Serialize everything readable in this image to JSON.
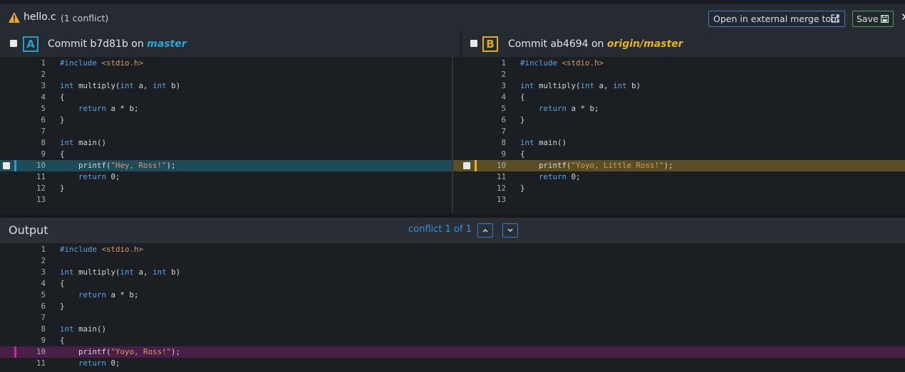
{
  "header": {
    "file_name": "hello.c",
    "conflict_count": "(1 conflict)",
    "external_tool_label": "Open in external merge tool",
    "save_label": "Save",
    "close_glyph": "✕"
  },
  "panel_a": {
    "badge": "A",
    "commit_label": "Commit b7d81b on ",
    "branch": "master",
    "accent": "#27a0c8"
  },
  "panel_b": {
    "badge": "B",
    "commit_label": "Commit ab4694 on ",
    "branch": "origin/master",
    "accent": "#e1ab20"
  },
  "output": {
    "title": "Output",
    "conflict_nav": "conflict 1 of 1",
    "accent": "#c0289e"
  },
  "code_a": [
    "1",
    "2",
    "3",
    "4",
    "5",
    "6",
    "7",
    "8",
    "9",
    "10",
    "11",
    "12",
    "13"
  ],
  "code_b": [
    "1",
    "2",
    "3",
    "4",
    "5",
    "6",
    "7",
    "8",
    "9",
    "10",
    "11",
    "12",
    "13"
  ],
  "code_out": [
    "1",
    "2",
    "3",
    "4",
    "5",
    "6",
    "7",
    "8",
    "9",
    "10",
    "11"
  ],
  "line_text": {
    "l1_pp": "#include",
    "l1_inc": " <stdio.h>",
    "l3_kw": "int",
    "l3_rest1": " multiply(",
    "l3_kw2": "int",
    "l3_rest2": " a, ",
    "l3_kw3": "int",
    "l3_rest3": " b)",
    "brace_open": "{",
    "l5_kw": "return",
    "l5_rest": " a * b;",
    "brace_close": "}",
    "l8_kw": "int",
    "l8_rest": " main()",
    "printf": "printf(",
    "str_a": "\"Hey, Ross!\"",
    "str_b": "\"Yoyo, Little Ross!\"",
    "str_out": "\"Yoyo, Ross!\"",
    "printf_end": ");",
    "l11_kw": "return",
    "l11_rest": " 0;"
  },
  "icons": {
    "warning": "warning-icon",
    "external": "external-link-icon",
    "save": "floppy-disk-icon",
    "up": "chevron-up-icon",
    "down": "chevron-down-icon"
  }
}
